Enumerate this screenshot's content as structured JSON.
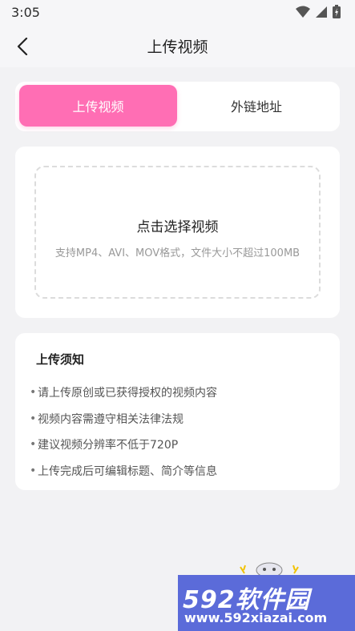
{
  "status_bar": {
    "time": "3:05"
  },
  "nav": {
    "title": "上传视频"
  },
  "tabs": [
    {
      "label": "上传视频",
      "active": true
    },
    {
      "label": "外链地址",
      "active": false
    }
  ],
  "upload": {
    "title": "点击选择视频",
    "hint": "支持MP4、AVI、MOV格式，文件大小不超过100MB"
  },
  "notice": {
    "title": "上传须知",
    "items": [
      "请上传原创或已获得授权的视频内容",
      "视频内容需遵守相关法律法规",
      "建议视频分辨率不低于720P",
      "上传完成后可编辑标题、简介等信息"
    ]
  },
  "watermark": {
    "top": "592软件园",
    "bottom": "www.592xiazai.com"
  },
  "colors": {
    "accent": "#ff6eb4",
    "watermark_bg": "#5b6bd9"
  }
}
